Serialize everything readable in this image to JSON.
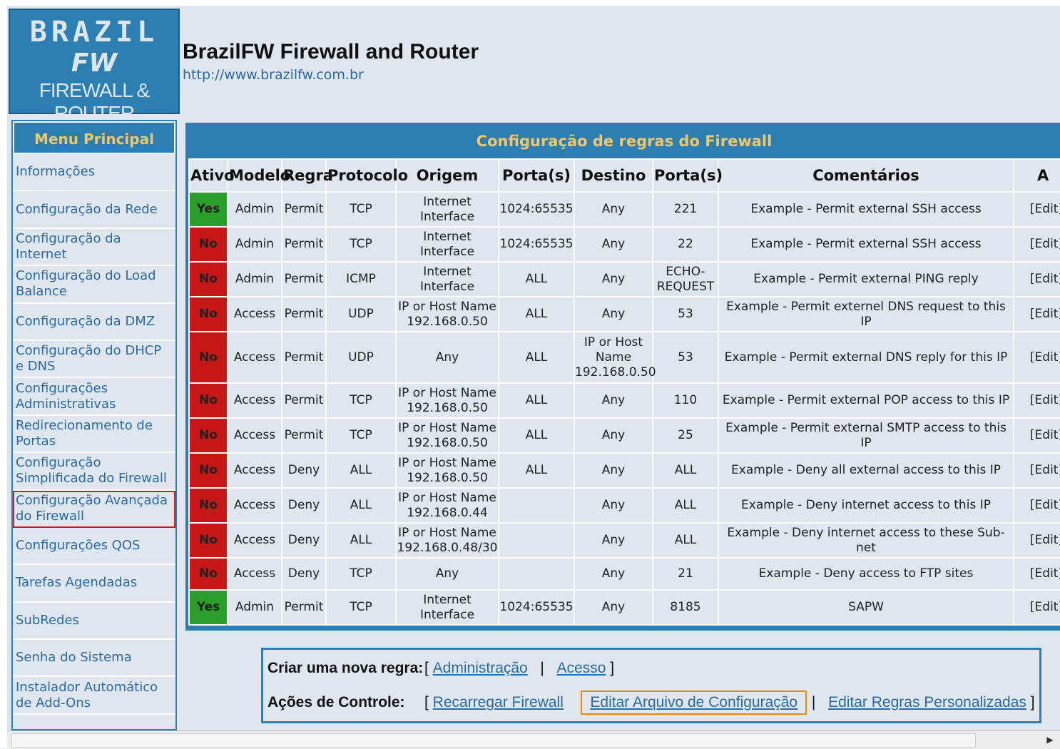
{
  "logo": {
    "line1": "BRAZIL",
    "line2": "FW",
    "line3": "FIREWALL & ROUTER"
  },
  "header": {
    "title": "BrazilFW Firewall and Router",
    "url": "http://www.brazilfw.com.br"
  },
  "sidebar": {
    "heading": "Menu Principal",
    "items": [
      {
        "label": "Informações"
      },
      {
        "label": "Configuração da Rede"
      },
      {
        "label": "Configuração da Internet"
      },
      {
        "label": "Configuração do Load Balance"
      },
      {
        "label": "Configuração da DMZ"
      },
      {
        "label": "Configuração do DHCP e DNS"
      },
      {
        "label": "Configurações Administrativas"
      },
      {
        "label": "Redirecionamento de Portas"
      },
      {
        "label": "Configuração Simplificada do Firewall"
      },
      {
        "label": "Configuração Avançada do Firewall",
        "highlighted": true
      },
      {
        "label": "Configurações QOS"
      },
      {
        "label": "Tarefas Agendadas"
      },
      {
        "label": "SubRedes"
      },
      {
        "label": "Senha do Sistema"
      },
      {
        "label": "Instalador Automático de Add-Ons"
      }
    ]
  },
  "panel": {
    "title": "Configuração de regras do Firewall",
    "columns": [
      "Ativo",
      "Modelo",
      "Regra",
      "Protocolo",
      "Origem",
      "Porta(s)",
      "Destino",
      "Porta(s)",
      "Comentários",
      "A"
    ],
    "rows": [
      {
        "ativo": "Yes",
        "modelo": "Admin",
        "regra": "Permit",
        "protocolo": "TCP",
        "origem": "Internet Interface",
        "porta_o": "1024:65535",
        "destino": "Any",
        "porta_d": "221",
        "comentario": "Example - Permit external SSH access",
        "acao": "[Edit]"
      },
      {
        "ativo": "No",
        "modelo": "Admin",
        "regra": "Permit",
        "protocolo": "TCP",
        "origem": "Internet Interface",
        "porta_o": "1024:65535",
        "destino": "Any",
        "porta_d": "22",
        "comentario": "Example - Permit external SSH access",
        "acao": "[Edit]"
      },
      {
        "ativo": "No",
        "modelo": "Admin",
        "regra": "Permit",
        "protocolo": "ICMP",
        "origem": "Internet Interface",
        "porta_o": "ALL",
        "destino": "Any",
        "porta_d": "ECHO-REQUEST",
        "comentario": "Example - Permit external PING reply",
        "acao": "[Edit]"
      },
      {
        "ativo": "No",
        "modelo": "Access",
        "regra": "Permit",
        "protocolo": "UDP",
        "origem": "IP or Host Name 192.168.0.50",
        "porta_o": "ALL",
        "destino": "Any",
        "porta_d": "53",
        "comentario": "Example - Permit externel DNS request to this IP",
        "acao": "[Edit]"
      },
      {
        "ativo": "No",
        "modelo": "Access",
        "regra": "Permit",
        "protocolo": "UDP",
        "origem": "Any",
        "porta_o": "ALL",
        "destino": "IP or Host Name 192.168.0.50",
        "porta_d": "53",
        "comentario": "Example - Permit external DNS reply for this IP",
        "acao": "[Edit]"
      },
      {
        "ativo": "No",
        "modelo": "Access",
        "regra": "Permit",
        "protocolo": "TCP",
        "origem": "IP or Host Name 192.168.0.50",
        "porta_o": "ALL",
        "destino": "Any",
        "porta_d": "110",
        "comentario": "Example - Permit external POP access to this IP",
        "acao": "[Edit]"
      },
      {
        "ativo": "No",
        "modelo": "Access",
        "regra": "Permit",
        "protocolo": "TCP",
        "origem": "IP or Host Name 192.168.0.50",
        "porta_o": "ALL",
        "destino": "Any",
        "porta_d": "25",
        "comentario": "Example - Permit external SMTP access to this IP",
        "acao": "[Edit]"
      },
      {
        "ativo": "No",
        "modelo": "Access",
        "regra": "Deny",
        "protocolo": "ALL",
        "origem": "IP or Host Name 192.168.0.50",
        "porta_o": "ALL",
        "destino": "Any",
        "porta_d": "ALL",
        "comentario": "Example - Deny all external access to this IP",
        "acao": "[Edit]"
      },
      {
        "ativo": "No",
        "modelo": "Access",
        "regra": "Deny",
        "protocolo": "ALL",
        "origem": "IP or Host Name 192.168.0.44",
        "porta_o": "",
        "destino": "Any",
        "porta_d": "ALL",
        "comentario": "Example - Deny internet access to this IP",
        "acao": "[Edit]"
      },
      {
        "ativo": "No",
        "modelo": "Access",
        "regra": "Deny",
        "protocolo": "ALL",
        "origem": "IP or Host Name 192.168.0.48/30",
        "porta_o": "",
        "destino": "Any",
        "porta_d": "ALL",
        "comentario": "Example - Deny internet access to these Sub-net",
        "acao": "[Edit]"
      },
      {
        "ativo": "No",
        "modelo": "Access",
        "regra": "Deny",
        "protocolo": "TCP",
        "origem": "Any",
        "porta_o": "",
        "destino": "Any",
        "porta_d": "21",
        "comentario": "Example - Deny access to FTP sites",
        "acao": "[Edit]"
      },
      {
        "ativo": "Yes",
        "modelo": "Admin",
        "regra": "Permit",
        "protocolo": "TCP",
        "origem": "Internet Interface",
        "porta_o": "1024:65535",
        "destino": "Any",
        "porta_d": "8185",
        "comentario": "SAPW",
        "acao": "[Edit]"
      }
    ]
  },
  "actions": {
    "new_rule_label": "Criar uma nova regra:",
    "new_rule_links": [
      "Administração",
      "Acesso"
    ],
    "control_label": "Ações de Controle:",
    "control_links": [
      "Recarregar Firewall",
      "Editar Arquivo de Configuração",
      "Editar Regras Personalizadas"
    ]
  },
  "colors": {
    "accent": "#2b7fb3",
    "heading_text": "#f0c66a",
    "yes": "#2aa02a",
    "no": "#c71616",
    "link": "#2b6aa0"
  }
}
